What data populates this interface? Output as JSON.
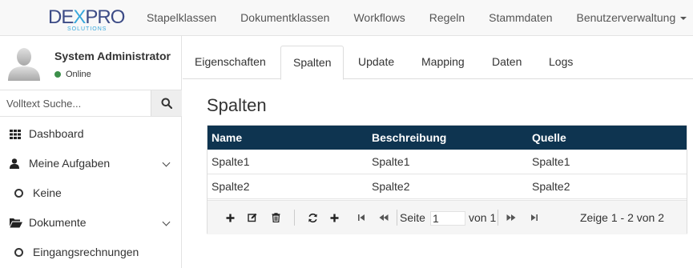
{
  "brand": {
    "logo_text_a": "DE",
    "logo_text_x": "X",
    "logo_text_b": "PRO",
    "logo_sub": "SOLUTIONS"
  },
  "topnav": [
    {
      "label": "Stapelklassen"
    },
    {
      "label": "Dokumentklassen"
    },
    {
      "label": "Workflows"
    },
    {
      "label": "Regeln"
    },
    {
      "label": "Stammdaten"
    },
    {
      "label": "Benutzerverwaltung"
    }
  ],
  "user": {
    "name": "System Administrator",
    "status": "Online",
    "status_color": "#3c8f4a"
  },
  "search": {
    "placeholder": "Volltext Suche...",
    "value": ""
  },
  "sidebar": {
    "items": [
      {
        "label": "Dashboard",
        "icon": "grid-icon"
      },
      {
        "label": "Meine Aufgaben",
        "icon": "user-icon"
      },
      {
        "label": "Keine",
        "icon": "circle-icon"
      },
      {
        "label": "Dokumente",
        "icon": "folder-open-icon"
      },
      {
        "label": "Eingangsrechnungen",
        "icon": "circle-icon"
      }
    ]
  },
  "tabs": [
    {
      "label": "Eigenschaften"
    },
    {
      "label": "Spalten"
    },
    {
      "label": "Update"
    },
    {
      "label": "Mapping"
    },
    {
      "label": "Daten"
    },
    {
      "label": "Logs"
    }
  ],
  "active_tab": "Spalten",
  "section_title": "Spalten",
  "table": {
    "header_color": "#0e3450",
    "columns": [
      "Name",
      "Beschreibung",
      "Quelle"
    ],
    "rows": [
      [
        "Spalte1",
        "Spalte1",
        "Spalte1"
      ],
      [
        "Spalte2",
        "Spalte2",
        "Spalte2"
      ]
    ]
  },
  "pager": {
    "page_label": "Seite",
    "page_value": "1",
    "of_label": "von 1",
    "summary": "Zeige 1 - 2 von 2"
  }
}
